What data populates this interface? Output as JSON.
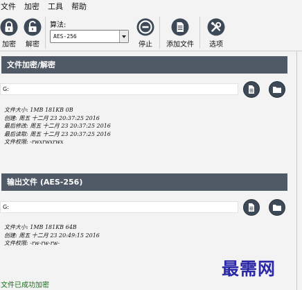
{
  "menu": [
    {
      "id": "file",
      "label": "文件"
    },
    {
      "id": "encrypt",
      "label": "加密"
    },
    {
      "id": "tools",
      "label": "工具"
    },
    {
      "id": "help",
      "label": "帮助"
    }
  ],
  "toolbar": {
    "encrypt_label": "加密",
    "decrypt_label": "解密",
    "algorithm_label": "算法:",
    "algorithm_value": "AES-256",
    "stop_label": "停止",
    "add_file_label": "添加文件",
    "options_label": "选项"
  },
  "input_section": {
    "title": "文件加密/解密",
    "path": "G:",
    "info": {
      "size": "文件大小: 1MB 181KB 0B",
      "created": "创建: 周五 十二月 23 20:37:25 2016",
      "modified": "最后修改: 周五 十二月 23 20:37:25 2016",
      "accessed": "最后读取: 周五 十二月 23 20:37:25 2016",
      "permissions": "文件权限: -rwxrwxrwx"
    }
  },
  "output_section": {
    "title": "输出文件 (AES-256)",
    "path": "G:",
    "info": {
      "size": "文件大小: 1MB 181KB 64B",
      "created": "创建: 周五 十二月 23 20:49:15 2016",
      "permissions": "文件权限: -rw-rw-rw-"
    }
  },
  "status": "文件已成功加密",
  "watermark": "最需网",
  "icons": {
    "encrypt": "lock-closed-icon",
    "decrypt": "lock-open-icon",
    "stop": "stop-icon",
    "add_file": "document-icon",
    "options": "tools-icon",
    "file_info": "document-icon",
    "browse": "folder-icon"
  },
  "colors": {
    "header_bg": "#4f5a66",
    "icon_dark": "#3d4956",
    "status_text": "#1b6f1b",
    "watermark": "#2a28a8"
  }
}
